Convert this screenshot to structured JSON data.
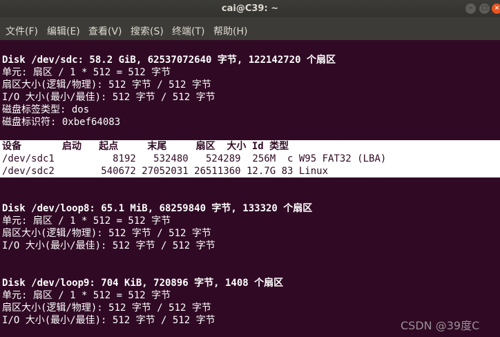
{
  "window": {
    "title": "cai@C39: ~",
    "buttons": [
      "–",
      "□",
      "×"
    ]
  },
  "menu": [
    "文件(F)",
    "编辑(E)",
    "查看(V)",
    "搜索(S)",
    "终端(T)",
    "帮助(H)"
  ],
  "terminal": {
    "sdc": [
      "Disk /dev/sdc: 58.2 GiB, 62537072640 字节, 122142720 个扇区",
      "单元: 扇区 / 1 * 512 = 512 字节",
      "扇区大小(逻辑/物理): 512 字节 / 512 字节",
      "I/O 大小(最小/最佳): 512 字节 / 512 字节",
      "磁盘标签类型: dos",
      "磁盘标识符: 0xbef64083"
    ],
    "table_header": "设备       启动   起点     末尾     扇区  大小 Id 类型",
    "table_rows": [
      "/dev/sdc1          8192   532480   524289  256M  c W95 FAT32 (LBA)",
      "/dev/sdc2        540672 27052031 26511360 12.7G 83 Linux"
    ],
    "loop8": [
      "Disk /dev/loop8: 65.1 MiB, 68259840 字节, 133320 个扇区",
      "单元: 扇区 / 1 * 512 = 512 字节",
      "扇区大小(逻辑/物理): 512 字节 / 512 字节",
      "I/O 大小(最小/最佳): 512 字节 / 512 字节"
    ],
    "loop9": [
      "Disk /dev/loop9: 704 KiB, 720896 字节, 1408 个扇区",
      "单元: 扇区 / 1 * 512 = 512 字节",
      "扇区大小(逻辑/物理): 512 字节 / 512 字节",
      "I/O 大小(最小/最佳): 512 字节 / 512 字节"
    ]
  },
  "watermark": "CSDN @39度C",
  "colors": {
    "terminal_bg": "#300a24",
    "selection_bg": "#ffffff",
    "close_button": "#e95420"
  }
}
